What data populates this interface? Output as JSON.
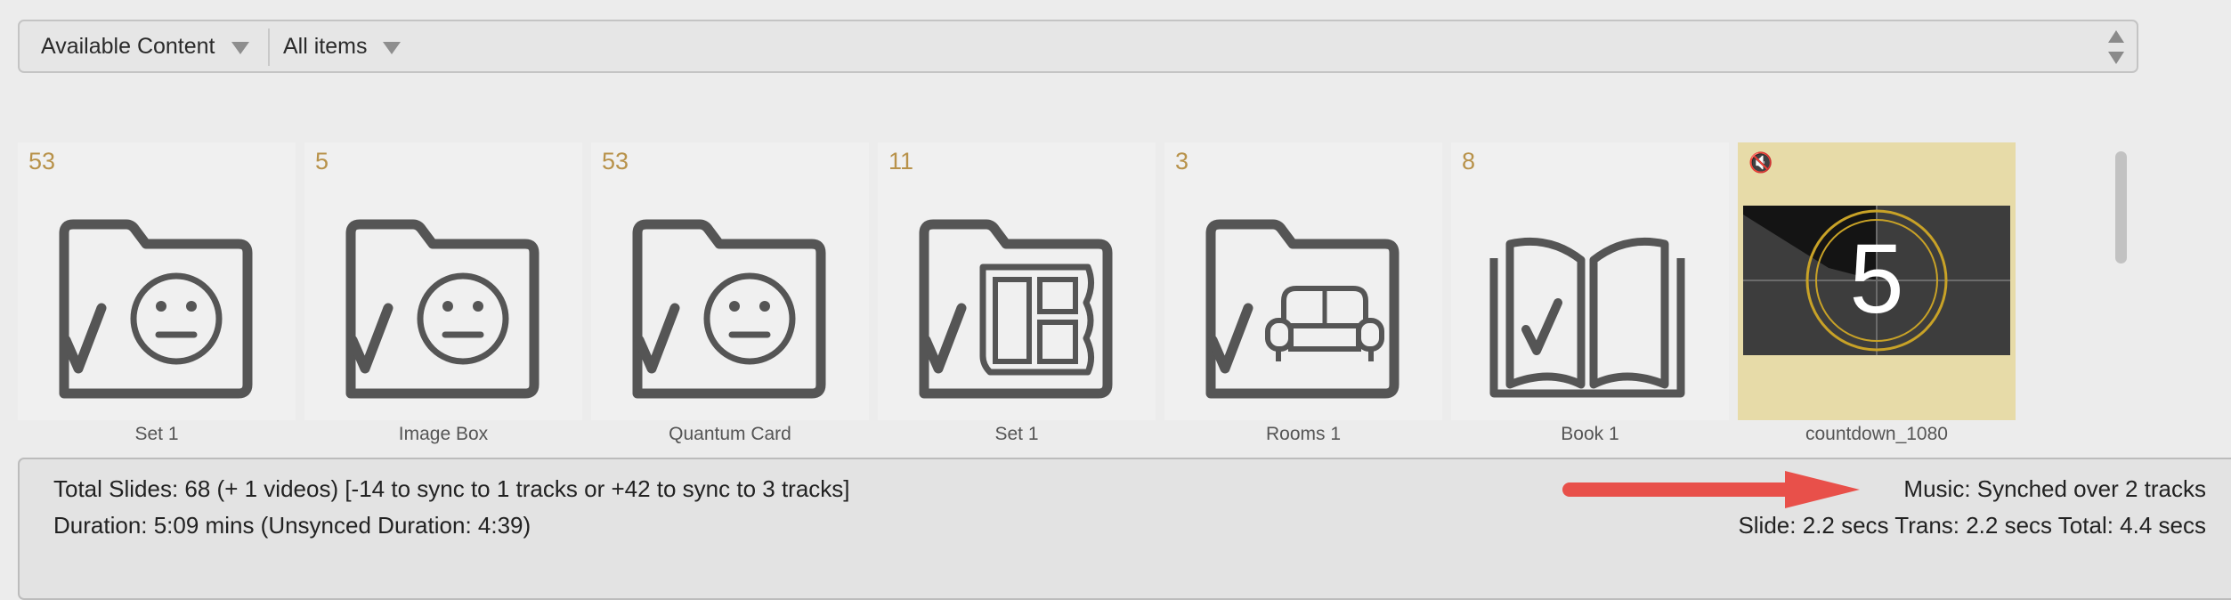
{
  "toolbar": {
    "source_label": "Available Content",
    "filter_label": "All items"
  },
  "items": [
    {
      "count": "53",
      "label": "Set 1",
      "icon": "folder-face-icon"
    },
    {
      "count": "5",
      "label": "Image Box",
      "icon": "folder-face-icon"
    },
    {
      "count": "53",
      "label": "Quantum Card",
      "icon": "folder-face-icon"
    },
    {
      "count": "11",
      "label": "Set 1",
      "icon": "folder-collage-icon"
    },
    {
      "count": "3",
      "label": "Rooms 1",
      "icon": "folder-sofa-icon"
    },
    {
      "count": "8",
      "label": "Book 1",
      "icon": "open-book-icon"
    },
    {
      "count": "",
      "label": "countdown_1080",
      "icon": "video-thumbnail",
      "muted_icon": "muted-speaker-icon",
      "countdown_number": "5"
    }
  ],
  "status": {
    "total_slides": "Total Slides: 68 (+ 1 videos)  [-14 to sync to 1 tracks or +42 to sync to 3 tracks]",
    "duration": "Duration: 5:09 mins  (Unsynced Duration: 4:39)",
    "music": "Music: Synched over 2 tracks",
    "timing": "Slide: 2.2 secs Trans: 2.2 secs  Total: 4.4 secs"
  },
  "colors": {
    "count_gold": "#b8924a",
    "selected_bg": "#e7dba8",
    "arrow_red": "#e8504a",
    "icon_gray": "#555555"
  }
}
